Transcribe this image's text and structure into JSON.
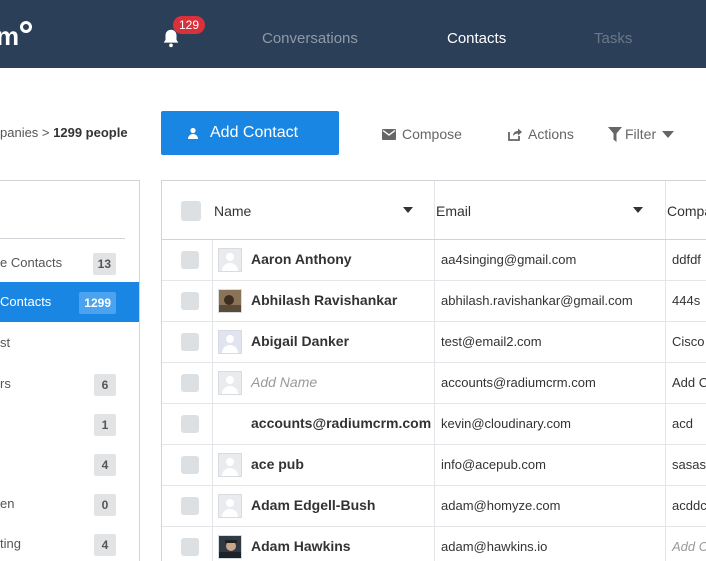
{
  "app": {
    "logo_text": "m",
    "notification_count": "129"
  },
  "nav": {
    "tabs": [
      {
        "label": "Conversations",
        "active": false
      },
      {
        "label": "Contacts",
        "active": true
      },
      {
        "label": "Tasks",
        "active": false
      }
    ]
  },
  "breadcrumb": {
    "prefix": "panies >",
    "current": "1299 people"
  },
  "toolbar": {
    "add_contact_label": "Add Contact",
    "compose_label": "Compose",
    "actions_label": "Actions",
    "filter_label": "Filter"
  },
  "segments": [
    {
      "label": "e Contacts",
      "count": "13",
      "active": false
    },
    {
      "label": "Contacts",
      "count": "1299",
      "active": true
    },
    {
      "label": "st",
      "count": "",
      "active": false
    },
    {
      "label": "rs",
      "count": "6",
      "active": false
    },
    {
      "label": "",
      "count": "1",
      "active": false
    },
    {
      "label": "",
      "count": "4",
      "active": false
    },
    {
      "label": "en",
      "count": "0",
      "active": false
    },
    {
      "label": "ting",
      "count": "4",
      "active": false
    }
  ],
  "table": {
    "columns": [
      "Name",
      "Email",
      "Compa"
    ],
    "rows": [
      {
        "name": "Aaron Anthony",
        "name_placeholder": false,
        "email": "aa4singing@gmail.com",
        "company": "ddfdf",
        "company_placeholder": false,
        "avatar": "default"
      },
      {
        "name": "Abhilash Ravishankar",
        "name_placeholder": false,
        "email": "abhilash.ravishankar@gmail.com",
        "company": "444s",
        "company_placeholder": false,
        "avatar": "photo"
      },
      {
        "name": "Abigail Danker",
        "name_placeholder": false,
        "email": "test@email2.com",
        "company": "Cisco",
        "company_placeholder": false,
        "avatar": "default-blue"
      },
      {
        "name": "Add Name",
        "name_placeholder": true,
        "email": "accounts@radiumcrm.com",
        "company": "Add C",
        "company_placeholder": false,
        "avatar": "default"
      },
      {
        "name": "accounts@radiumcrm.com",
        "name_placeholder": false,
        "email": "kevin@cloudinary.com",
        "company": "acd",
        "company_placeholder": false,
        "avatar": "none"
      },
      {
        "name": "ace pub",
        "name_placeholder": false,
        "email": "info@acepub.com",
        "company": "sasas",
        "company_placeholder": false,
        "avatar": "default"
      },
      {
        "name": "Adam Edgell-Bush",
        "name_placeholder": false,
        "email": "adam@homyze.com",
        "company": "acddc",
        "company_placeholder": false,
        "avatar": "default"
      },
      {
        "name": "Adam Hawkins",
        "name_placeholder": false,
        "email": "adam@hawkins.io",
        "company": "Add C",
        "company_placeholder": true,
        "avatar": "photo2"
      }
    ]
  },
  "colors": {
    "nav_bg": "#2b3f58",
    "accent": "#1a86e3",
    "badge": "#d9313c"
  }
}
